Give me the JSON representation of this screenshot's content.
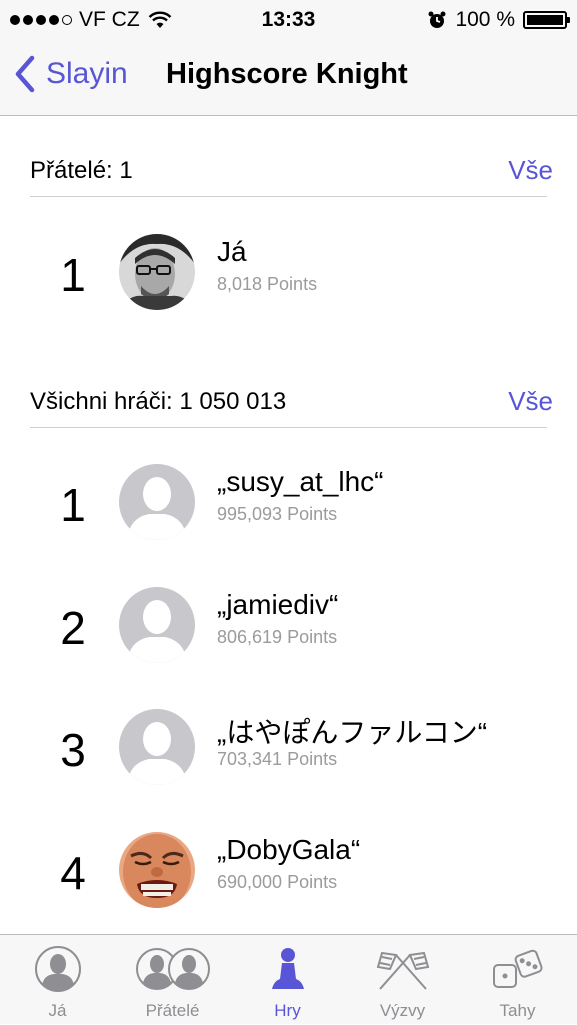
{
  "status_bar": {
    "carrier": "VF CZ",
    "time": "13:33",
    "battery": "100 %"
  },
  "nav": {
    "back_label": "Slayin",
    "title": "Highscore Knight"
  },
  "friends": {
    "header": "Přátelé: 1",
    "all_label": "Vše",
    "entries": [
      {
        "rank": "1",
        "name": "Já",
        "points": "8,018 Points",
        "avatar": "photo-man-glasses"
      }
    ]
  },
  "all_players": {
    "header": "Všichni hráči: 1 050 013",
    "all_label": "Vše",
    "entries": [
      {
        "rank": "1",
        "name": "„susy_at_lhc“",
        "points": "995,093 Points",
        "avatar": "default-silhouette"
      },
      {
        "rank": "2",
        "name": "„jamiediv“",
        "points": "806,619 Points",
        "avatar": "default-silhouette"
      },
      {
        "rank": "3",
        "name": "„はやぽんファルコン“",
        "points": "703,341 Points",
        "avatar": "default-silhouette"
      },
      {
        "rank": "4",
        "name": "„DobyGala“",
        "points": "690,000 Points",
        "avatar": "photo-face"
      }
    ]
  },
  "tabs": [
    {
      "label": "Já",
      "icon": "person-icon"
    },
    {
      "label": "Přátelé",
      "icon": "friends-icon"
    },
    {
      "label": "Hry",
      "icon": "pawn-icon",
      "active": true
    },
    {
      "label": "Výzvy",
      "icon": "crossed-flags-icon"
    },
    {
      "label": "Tahy",
      "icon": "dice-icon"
    }
  ],
  "colors": {
    "accent": "#5856d6",
    "tab_inactive": "#8e8e93",
    "secondary_text": "#9b9b9b"
  }
}
